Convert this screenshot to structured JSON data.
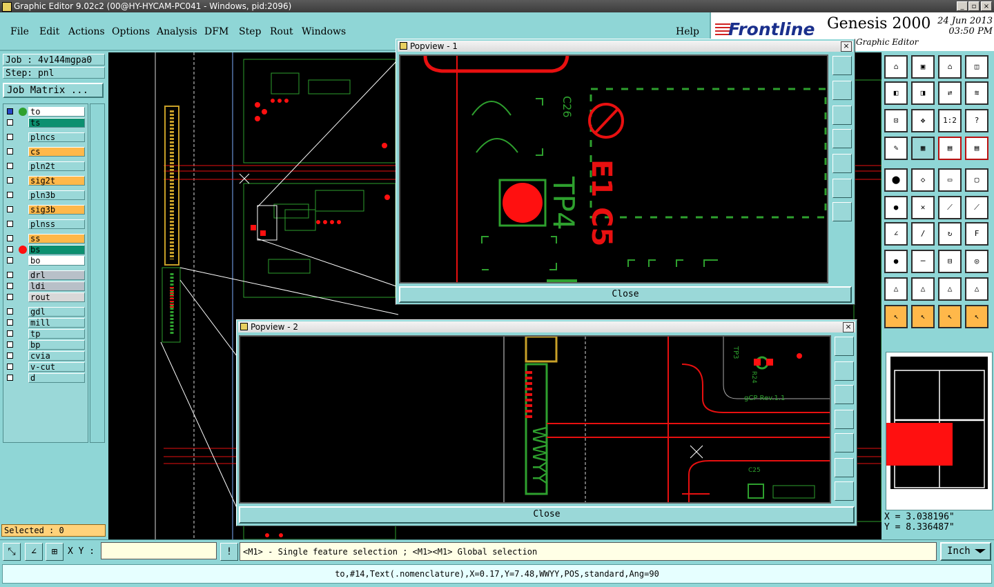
{
  "window": {
    "title": "Graphic Editor 9.02c2 (00@HY-HYCAM-PC041 - Windows, pid:2096)"
  },
  "menu": {
    "items": [
      "File",
      "Edit",
      "Actions",
      "Options",
      "Analysis",
      "DFM",
      "Step",
      "Rout",
      "Windows"
    ],
    "help": "Help"
  },
  "logo": {
    "brand": "Frontline",
    "product": "Genesis 2000",
    "date": "24 Jun 2013",
    "time": "03:50 PM",
    "subtitle": "Graphic Editor"
  },
  "job": {
    "job_line": "Job : 4v144mgpa0",
    "step_line": "Step: pnl",
    "matrix_button": "Job Matrix ..."
  },
  "layers": [
    {
      "name": "to",
      "color": "#ffffff",
      "dot": "#2ea02e",
      "selected": true
    },
    {
      "name": "ts",
      "color": "#0c9070",
      "dot": ""
    },
    {
      "name": "plncs",
      "color": "#9ad8d8",
      "dot": ""
    },
    {
      "name": "cs",
      "color": "#ffb84a",
      "dot": ""
    },
    {
      "name": "pln2t",
      "color": "#9ad8d8",
      "dot": ""
    },
    {
      "name": "sig2t",
      "color": "#ffb84a",
      "dot": ""
    },
    {
      "name": "pln3b",
      "color": "#9ad8d8",
      "dot": ""
    },
    {
      "name": "sig3b",
      "color": "#ffb84a",
      "dot": ""
    },
    {
      "name": "plnss",
      "color": "#9ad8d8",
      "dot": ""
    },
    {
      "name": "ss",
      "color": "#ffb84a",
      "dot": ""
    },
    {
      "name": "bs",
      "color": "#0c9070",
      "dot": "#ff1010"
    },
    {
      "name": "bo",
      "color": "#ffffff",
      "dot": ""
    },
    {
      "name": "drl",
      "color": "#b8c0c8",
      "dot": ""
    },
    {
      "name": "ldi",
      "color": "#b8c0c8",
      "dot": ""
    },
    {
      "name": "rout",
      "color": "#d8d8d8",
      "dot": ""
    },
    {
      "name": "gdl",
      "color": "#9ad8d8",
      "dot": ""
    },
    {
      "name": "mill",
      "color": "#9ad8d8",
      "dot": ""
    },
    {
      "name": "tp",
      "color": "#9ad8d8",
      "dot": ""
    },
    {
      "name": "bp",
      "color": "#9ad8d8",
      "dot": ""
    },
    {
      "name": "cvia",
      "color": "#9ad8d8",
      "dot": ""
    },
    {
      "name": "v-cut",
      "color": "#9ad8d8",
      "dot": ""
    },
    {
      "name": "d",
      "color": "#9ad8d8",
      "dot": ""
    }
  ],
  "selected_count": "Selected : 0",
  "popview1": {
    "title": "Popview - 1",
    "close_label": "Close",
    "labels": {
      "c26": "C26",
      "tp4": "TP4",
      "e15": "E1 C5"
    }
  },
  "popview2": {
    "title": "Popview - 2",
    "close_label": "Close",
    "labels": {
      "wwyy": "WWYY",
      "tp3": "TP3",
      "rev": "gCP Rev.1.1",
      "c25": "C25",
      "r24": "R24"
    }
  },
  "coords": {
    "x": "X = 3.038196\"",
    "y": "Y = 8.336487\""
  },
  "command": {
    "xy_label": "X Y :",
    "xy_value": "",
    "hint": "<M1> - Single feature selection ; <M1><M1> Global selection",
    "unit": "Inch"
  },
  "status": {
    "text": "to,#14,Text(.nomenclature),X=0.17,Y=7.48,WWYY,POS,standard,Ang=90"
  },
  "toolbar_icons": [
    "zoom-home-icon",
    "zoom-back-icon",
    "home-view-icon",
    "split-view-icon",
    "pan-left-icon",
    "pan-right-icon",
    "mirror-icon",
    "snap-icon",
    "fit-icon",
    "center-icon",
    "scale-one-to-one-icon",
    "help-query-icon",
    "measure-icon",
    "grid-icon",
    "layer-compare-icon",
    "layer-compare-active-icon",
    "select-point-icon",
    "polygon-icon",
    "ruler-icon",
    "rectangle-select-icon",
    "node-connect-icon",
    "cross-icon",
    "line-node-icon",
    "line-arrow-icon",
    "angle-icon",
    "draw-line-icon",
    "arc-icon",
    "text-icon",
    "pad-add-icon",
    "split-line-icon",
    "dimension-icon",
    "surface-icon",
    "triangle-outline-icon",
    "triangle-fill-icon",
    "triangle-measure-icon",
    "triangle-dim-icon",
    "pointer-icon",
    "pointer-select-icon",
    "pointer-edit-icon",
    "pointer-node-icon"
  ],
  "colors": {
    "panel": "#8fd6d6",
    "canvas": "#000000",
    "copper": "#ff1010",
    "silk": "#2ea02e",
    "accent": "#ffb84a"
  }
}
